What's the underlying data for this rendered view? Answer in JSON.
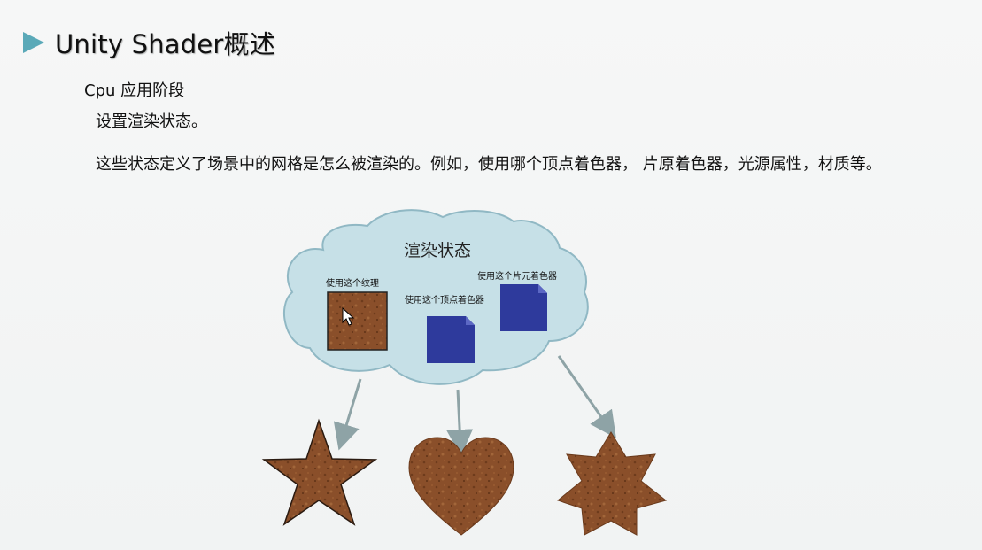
{
  "slide": {
    "title": "Unity Shader概述",
    "subheading": "Cpu 应用阶段",
    "paragraphs": [
      "设置渲染状态。",
      "这些状态定义了场景中的网格是怎么被渲染的。例如，使用哪个顶点着色器， 片原着色器，光源属性，材质等。"
    ]
  },
  "diagram": {
    "cloud_label": "渲染状态",
    "texture_label": "使用这个纹理",
    "vertex_shader_label": "使用这个顶点着色器",
    "fragment_shader_label": "使用这个片元着色器",
    "output_shapes": [
      "star-icon",
      "heart-icon",
      "hexagram-icon"
    ],
    "colors": {
      "accent_arrow": "#5aa9b8",
      "cloud_fill": "#c6e0e7",
      "cloud_stroke": "#90b8c4",
      "shader_doc": "#2e3a9c",
      "leather": "#8a4f2a",
      "connector": "#8ea3a6"
    }
  }
}
